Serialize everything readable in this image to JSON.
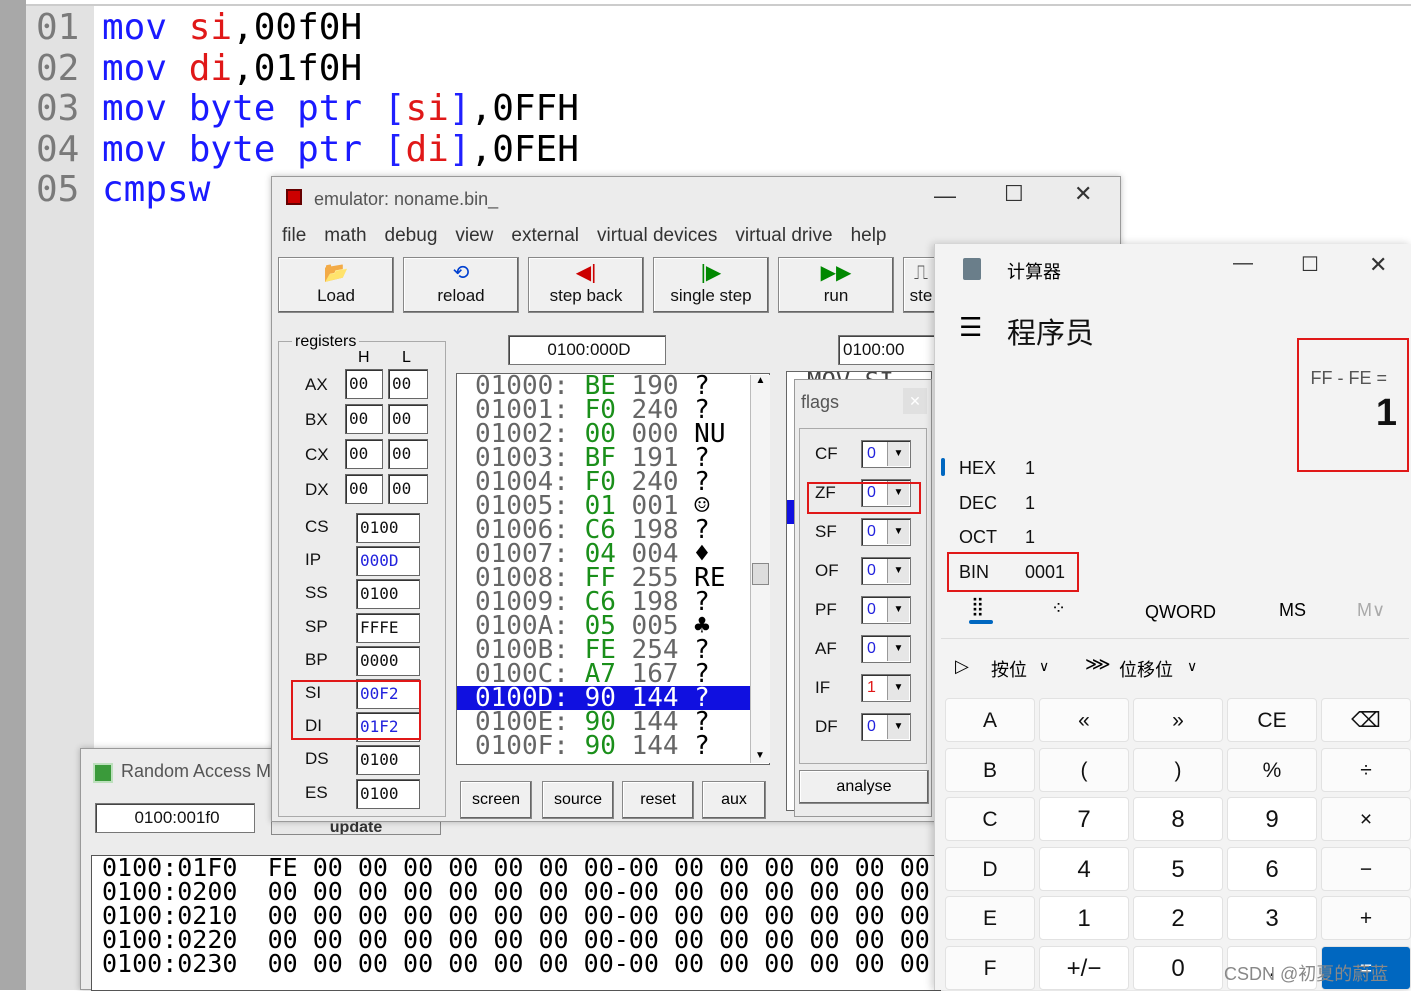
{
  "editor": {
    "lines": [
      {
        "num": "01",
        "op": "mov",
        "args": [
          {
            "t": "si",
            "c": "rg"
          },
          {
            "t": ",00f0H",
            "c": "tx"
          }
        ]
      },
      {
        "num": "02",
        "op": "mov",
        "args": [
          {
            "t": "di",
            "c": "rg"
          },
          {
            "t": ",01f0H",
            "c": "tx"
          }
        ]
      },
      {
        "num": "03",
        "op": "mov",
        "args": [
          {
            "t": "byte ptr ",
            "c": "kw"
          },
          {
            "t": "[",
            "c": "br"
          },
          {
            "t": "si",
            "c": "rg"
          },
          {
            "t": "]",
            "c": "br"
          },
          {
            "t": ",0FFH",
            "c": "tx"
          }
        ]
      },
      {
        "num": "04",
        "op": "mov",
        "args": [
          {
            "t": "byte ptr ",
            "c": "kw"
          },
          {
            "t": "[",
            "c": "br"
          },
          {
            "t": "di",
            "c": "rg"
          },
          {
            "t": "]",
            "c": "br"
          },
          {
            "t": ",0FEH",
            "c": "tx"
          }
        ]
      },
      {
        "num": "05",
        "op": "cmpsw",
        "args": []
      }
    ]
  },
  "emulator": {
    "title": "emulator: noname.bin_",
    "menu": [
      "file",
      "math",
      "debug",
      "view",
      "external",
      "virtual devices",
      "virtual drive",
      "help"
    ],
    "toolbar": [
      {
        "label": "Load",
        "icon": "📂"
      },
      {
        "label": "reload",
        "icon": "⟲"
      },
      {
        "label": "step back",
        "icon": "◀|"
      },
      {
        "label": "single step",
        "icon": "|▶"
      },
      {
        "label": "run",
        "icon": "▶▶"
      },
      {
        "label": "ste",
        "icon": "⎍"
      }
    ],
    "addr1": "0100:000D",
    "addr2": "0100:00",
    "registers_label": "registers",
    "h_label": "H",
    "l_label": "L",
    "gp": [
      {
        "name": "AX",
        "h": "00",
        "l": "00"
      },
      {
        "name": "BX",
        "h": "00",
        "l": "00"
      },
      {
        "name": "CX",
        "h": "00",
        "l": "00"
      },
      {
        "name": "DX",
        "h": "00",
        "l": "00"
      }
    ],
    "seg": [
      {
        "name": "CS",
        "v": "0100",
        "blue": false
      },
      {
        "name": "IP",
        "v": "000D",
        "blue": true
      },
      {
        "name": "SS",
        "v": "0100",
        "blue": false
      },
      {
        "name": "SP",
        "v": "FFFE",
        "blue": false
      },
      {
        "name": "BP",
        "v": "0000",
        "blue": false
      },
      {
        "name": "SI",
        "v": "00F2",
        "blue": true
      },
      {
        "name": "DI",
        "v": "01F2",
        "blue": true
      },
      {
        "name": "DS",
        "v": "0100",
        "blue": false
      },
      {
        "name": "ES",
        "v": "0100",
        "blue": false
      }
    ],
    "memory": [
      {
        "a": "01000:",
        "h": "BE",
        "d": "190",
        "c": "?"
      },
      {
        "a": "01001:",
        "h": "F0",
        "d": "240",
        "c": "?"
      },
      {
        "a": "01002:",
        "h": "00",
        "d": "000",
        "c": "NU"
      },
      {
        "a": "01003:",
        "h": "BF",
        "d": "191",
        "c": "?"
      },
      {
        "a": "01004:",
        "h": "F0",
        "d": "240",
        "c": "?"
      },
      {
        "a": "01005:",
        "h": "01",
        "d": "001",
        "c": "☺"
      },
      {
        "a": "01006:",
        "h": "C6",
        "d": "198",
        "c": "?"
      },
      {
        "a": "01007:",
        "h": "04",
        "d": "004",
        "c": "♦"
      },
      {
        "a": "01008:",
        "h": "FF",
        "d": "255",
        "c": "RE"
      },
      {
        "a": "01009:",
        "h": "C6",
        "d": "198",
        "c": "?"
      },
      {
        "a": "0100A:",
        "h": "05",
        "d": "005",
        "c": "♣"
      },
      {
        "a": "0100B:",
        "h": "FE",
        "d": "254",
        "c": "?"
      },
      {
        "a": "0100C:",
        "h": "A7",
        "d": "167",
        "c": "?"
      },
      {
        "a": "0100D:",
        "h": "90",
        "d": "144",
        "c": "?",
        "sel": true
      },
      {
        "a": "0100E:",
        "h": "90",
        "d": "144",
        "c": "?"
      },
      {
        "a": "0100F:",
        "h": "90",
        "d": "144",
        "c": "?"
      }
    ],
    "disasm_peek": "MOV SI",
    "bottom_buttons": [
      "screen",
      "source",
      "reset",
      "aux"
    ],
    "flags_title": "flags",
    "flags": [
      {
        "n": "CF",
        "v": "0"
      },
      {
        "n": "ZF",
        "v": "0"
      },
      {
        "n": "SF",
        "v": "0"
      },
      {
        "n": "OF",
        "v": "0"
      },
      {
        "n": "PF",
        "v": "0"
      },
      {
        "n": "AF",
        "v": "0"
      },
      {
        "n": "IF",
        "v": "1"
      },
      {
        "n": "DF",
        "v": "0"
      }
    ],
    "analyse": "analyse"
  },
  "ram": {
    "title": "Random Access M",
    "address": "0100:001f0",
    "update": "update",
    "rows": [
      {
        "a": "0100:01F0",
        "b": "FE 00 00 00 00 00 00 00-00 00 00 00 00 00 00 00"
      },
      {
        "a": "0100:0200",
        "b": "00 00 00 00 00 00 00 00-00 00 00 00 00 00 00 00"
      },
      {
        "a": "0100:0210",
        "b": "00 00 00 00 00 00 00 00-00 00 00 00 00 00 00 00"
      },
      {
        "a": "0100:0220",
        "b": "00 00 00 00 00 00 00 00-00 00 00 00 00 00 00 00"
      },
      {
        "a": "0100:0230",
        "b": "00 00 00 00 00 00 00 00-00 00 00 00 00 00 00 00"
      }
    ]
  },
  "calc": {
    "title": "计算器",
    "mode": "程序员",
    "expression": "FF - FE =",
    "result": "1",
    "bases": [
      {
        "n": "HEX",
        "v": "1"
      },
      {
        "n": "DEC",
        "v": "1"
      },
      {
        "n": "OCT",
        "v": "1"
      },
      {
        "n": "BIN",
        "v": "0001"
      }
    ],
    "word": "QWORD",
    "ms": "MS",
    "mv": "M∨",
    "bitwise": "按位",
    "bitshift": "位移位",
    "keys": [
      [
        "A",
        "«",
        "»",
        "CE",
        "⌫"
      ],
      [
        "B",
        "(",
        ")",
        "%",
        "÷"
      ],
      [
        "C",
        "7",
        "8",
        "9",
        "×"
      ],
      [
        "D",
        "4",
        "5",
        "6",
        "−"
      ],
      [
        "E",
        "1",
        "2",
        "3",
        "+"
      ],
      [
        "F",
        "+/−",
        "0",
        ".",
        "="
      ]
    ]
  },
  "watermark": "CSDN @初夏的蔚蓝"
}
